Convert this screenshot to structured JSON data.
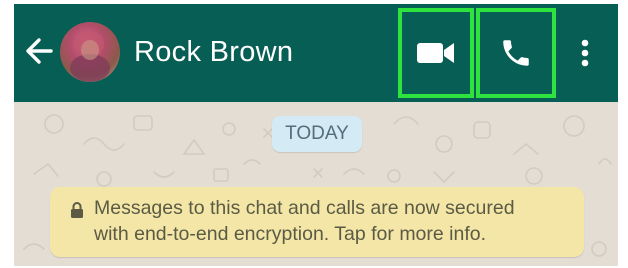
{
  "header": {
    "contact_name": "Rock Brown",
    "back_icon": "arrow-left-icon",
    "avatar_icon": "profile-photo",
    "video_call_icon": "videocam-icon",
    "voice_call_icon": "phone-icon",
    "menu_icon": "more-vert-icon"
  },
  "chat": {
    "date_chip": "TODAY",
    "encryption_notice": {
      "icon": "lock-icon",
      "line1": "Messages to this chat and calls are now secured",
      "line2": "with end-to-end encryption. Tap for more info."
    }
  },
  "colors": {
    "app_bar": "#075e54",
    "highlight_outline": "#2fe33f",
    "chat_background": "#e4ddd4",
    "date_chip_bg": "#d4eaf4",
    "notice_bg": "#f3e6a7"
  }
}
